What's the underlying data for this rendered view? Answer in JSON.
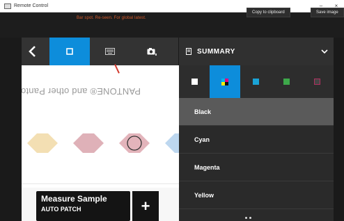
{
  "window": {
    "title": "Remote Control",
    "minimize_glyph": "–",
    "close_glyph": "×"
  },
  "appbar": {
    "hint": "Bar spot. Re-seen. For global latest.",
    "copy_button": "Copy to clipboard",
    "save_button": "Save image"
  },
  "toolbar": {
    "back_icon": "chevron-left-icon",
    "tools": [
      "frame-icon",
      "keyboard-icon",
      "camera-icon"
    ],
    "active_tool_color": "#0d8ddb"
  },
  "canvas": {
    "mirrored_text": "PANTONE® and other Pantone"
  },
  "measure": {
    "title": "Measure Sample",
    "subtitle": "AUTO PATCH",
    "add_label": "+"
  },
  "panel": {
    "title": "SUMMARY",
    "chevron_icon": "chevron-down-icon",
    "channels": [
      "paper",
      "cmyk",
      "cyan",
      "green",
      "dark"
    ],
    "active_channel": "cmyk",
    "inks": [
      "Black",
      "Cyan",
      "Magenta",
      "Yellow"
    ],
    "selected_ink": "Black"
  }
}
